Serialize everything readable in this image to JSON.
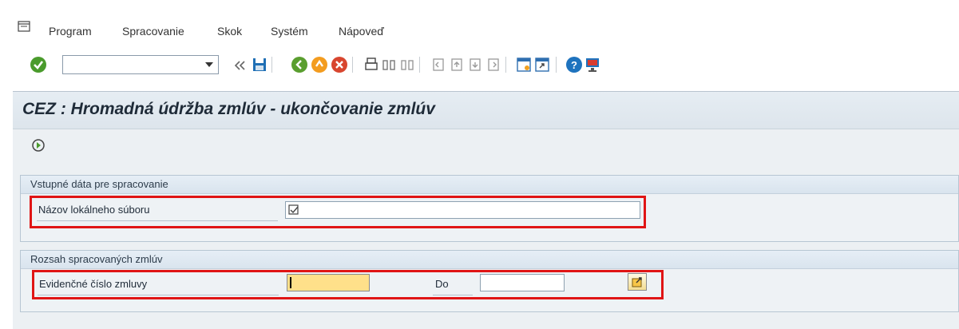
{
  "menubar": {
    "icon": "menu-window-icon",
    "items": [
      {
        "label": "Program"
      },
      {
        "label": "Spracovanie"
      },
      {
        "label": "Skok"
      },
      {
        "label": "Systém"
      },
      {
        "label": "Nápoveď"
      }
    ]
  },
  "toolbar": {
    "icons": [
      "check-icon",
      "back-icon",
      "save-icon",
      "back-nav-icon",
      "exit-icon",
      "cancel-icon",
      "print-icon",
      "find-icon",
      "find-next-icon",
      "first-page-icon",
      "prev-page-icon",
      "next-page-icon",
      "last-page-icon",
      "new-session-icon",
      "shortcut-icon",
      "help-icon",
      "customize-icon"
    ]
  },
  "page": {
    "title": "CEZ : Hromadná údržba zmlúv - ukončovanie zmlúv",
    "execute_icon": "execute-icon"
  },
  "input_group": {
    "title": "Vstupné dáta pre spracovanie",
    "file_label": "Názov lokálneho súboru",
    "file_value": ""
  },
  "range_group": {
    "title": "Rozsah spracovaných zmlúv",
    "contract_label": "Evidenčné číslo zmluvy",
    "from_value": "",
    "to_label": "Do",
    "to_value": ""
  },
  "colors": {
    "highlight": "#e01515",
    "input_active": "#ffe08a",
    "panel": "#eef2f5"
  }
}
